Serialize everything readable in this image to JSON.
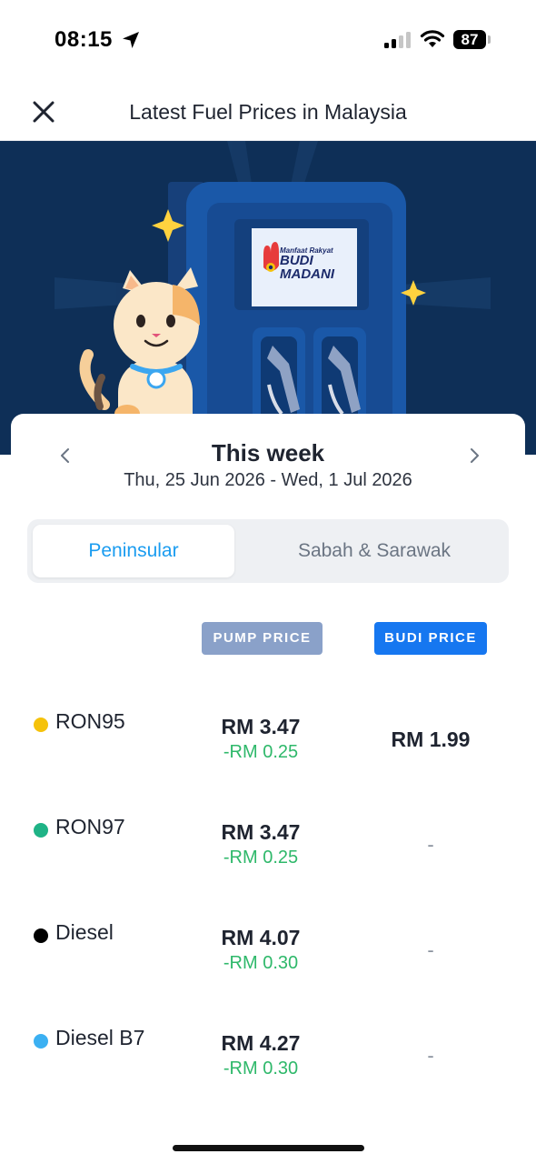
{
  "status_bar": {
    "time": "08:15",
    "battery": "87",
    "icons": [
      "location-arrow-icon",
      "cellular-signal-icon",
      "wifi-icon",
      "battery-icon"
    ]
  },
  "header": {
    "title": "Latest Fuel Prices in Malaysia",
    "close_icon": "close-icon"
  },
  "hero": {
    "sign_small_text": "Manfaat Rakyat",
    "sign_line1": "BUDI",
    "sign_line2": "MADANI",
    "colors": {
      "background": "#0e2f57",
      "pump": "#1a58a8",
      "sparkle": "#ffd23f"
    }
  },
  "week": {
    "title": "This week",
    "range": "Thu, 25 Jun 2026 - Wed, 1 Jul 2026"
  },
  "tabs": [
    {
      "label": "Peninsular",
      "active": true
    },
    {
      "label": "Sabah & Sarawak",
      "active": false
    }
  ],
  "columns": {
    "pump": "PUMP PRICE",
    "budi": "BUDI PRICE"
  },
  "fuels": [
    {
      "name": "RON95",
      "dot_color": "#f5c20b",
      "pump_price": "RM 3.47",
      "change": "-RM 0.25",
      "budi_price": "RM 1.99"
    },
    {
      "name": "RON97",
      "dot_color": "#1fb386",
      "pump_price": "RM 3.47",
      "change": "-RM 0.25",
      "budi_price": "-"
    },
    {
      "name": "Diesel",
      "dot_color": "#000000",
      "pump_price": "RM 4.07",
      "change": "-RM 0.30",
      "budi_price": "-"
    },
    {
      "name": "Diesel B7",
      "dot_color": "#3bb0f2",
      "pump_price": "RM 4.27",
      "change": "-RM 0.30",
      "budi_price": "-"
    }
  ],
  "colors": {
    "accent": "#1a9cf0",
    "budi_badge": "#1677f0",
    "pump_badge": "#8aa1c9",
    "change_green": "#2eb86a"
  }
}
